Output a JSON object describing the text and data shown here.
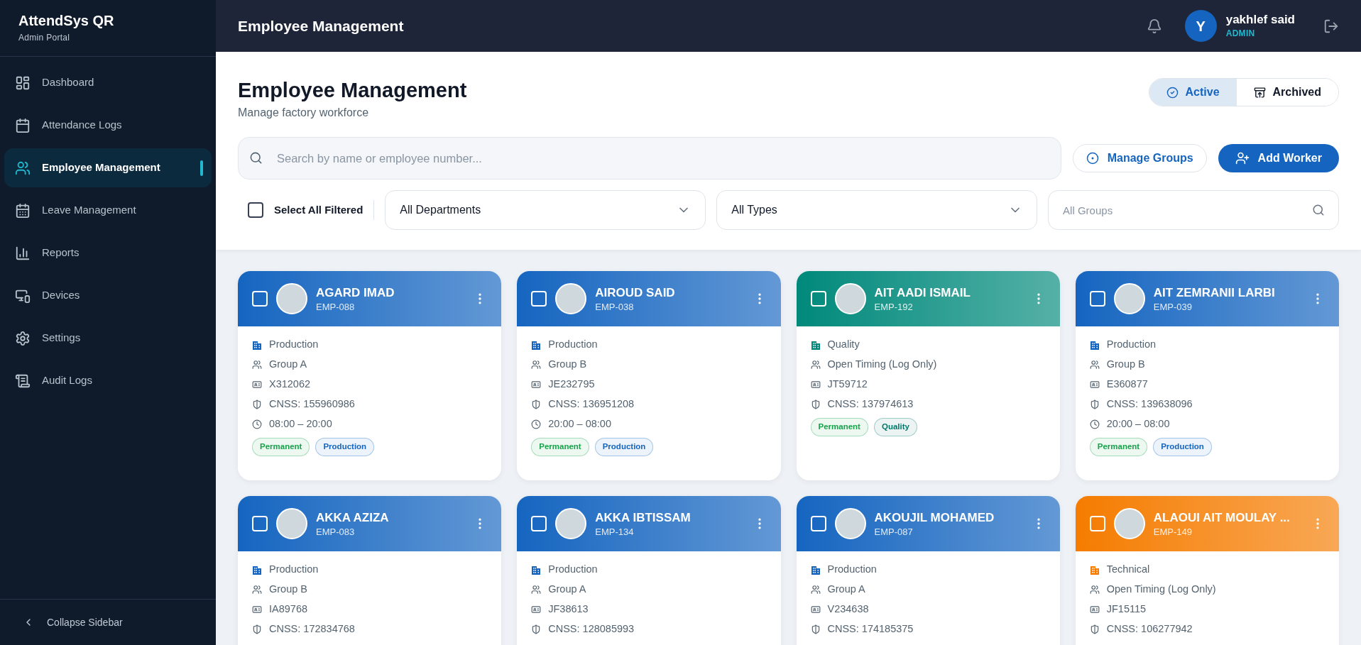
{
  "sidebar": {
    "brand": "AttendSys QR",
    "subtitle": "Admin Portal",
    "items": [
      {
        "label": "Dashboard",
        "selected": false
      },
      {
        "label": "Attendance Logs",
        "selected": false
      },
      {
        "label": "Employee Management",
        "selected": true
      },
      {
        "label": "Leave Management",
        "selected": false
      },
      {
        "label": "Reports",
        "selected": false
      },
      {
        "label": "Devices",
        "selected": false
      },
      {
        "label": "Settings",
        "selected": false
      },
      {
        "label": "Audit Logs",
        "selected": false
      }
    ],
    "collapse": "Collapse Sidebar"
  },
  "topbar": {
    "title": "Employee Management",
    "user": {
      "initial": "Y",
      "name": "yakhlef said",
      "role": "ADMIN"
    }
  },
  "header": {
    "title": "Employee Management",
    "subtitle": "Manage factory workforce",
    "status_toggle": [
      {
        "label": "Active",
        "selected": true
      },
      {
        "label": "Archived",
        "selected": false
      }
    ],
    "search": {
      "placeholder": "Search by name or employee number..."
    },
    "manage_groups": "Manage Groups",
    "add_worker": "Add Worker",
    "select_all": {
      "label": "Select All Filtered",
      "checked": false
    },
    "department_filter": "All Departments",
    "type_filter": "All Types",
    "group_filter": {
      "placeholder": "All Groups"
    }
  },
  "employees": [
    {
      "name": "AGARD IMAD",
      "id": "EMP-088",
      "color": "#1565c0",
      "checked": false,
      "department": "Production",
      "group": "Group A",
      "document": "X312062",
      "cnss": "CNSS: 155960986",
      "schedule": "08:00 – 20:00",
      "tags": [
        {
          "label": "Permanent",
          "color": "#16a34a"
        },
        {
          "label": "Production",
          "color": "#1565c0"
        }
      ]
    },
    {
      "name": "AIROUD SAID",
      "id": "EMP-038",
      "color": "#1565c0",
      "checked": false,
      "department": "Production",
      "group": "Group B",
      "document": "JE232795",
      "cnss": "CNSS: 136951208",
      "schedule": "20:00 – 08:00",
      "tags": [
        {
          "label": "Permanent",
          "color": "#16a34a"
        },
        {
          "label": "Production",
          "color": "#1565c0"
        }
      ]
    },
    {
      "name": "AIT AADI ISMAIL",
      "id": "EMP-192",
      "color": "#00897b",
      "checked": false,
      "department": "Quality",
      "group": "Open Timing (Log Only)",
      "document": "JT59712",
      "cnss": "CNSS: 137974613",
      "tags": [
        {
          "label": "Permanent",
          "color": "#16a34a"
        },
        {
          "label": "Quality",
          "color": "#00796b"
        }
      ]
    },
    {
      "name": "AIT ZEMRANII LARBI",
      "id": "EMP-039",
      "color": "#1565c0",
      "checked": false,
      "department": "Production",
      "group": "Group B",
      "document": "E360877",
      "cnss": "CNSS: 139638096",
      "schedule": "20:00 – 08:00",
      "tags": [
        {
          "label": "Permanent",
          "color": "#16a34a"
        },
        {
          "label": "Production",
          "color": "#1565c0"
        }
      ]
    },
    {
      "name": "AKKA AZIZA",
      "id": "EMP-083",
      "color": "#1565c0",
      "checked": false,
      "department": "Production",
      "group": "Group B",
      "document": "IA89768",
      "cnss": "CNSS: 172834768"
    },
    {
      "name": "AKKA IBTISSAM",
      "id": "EMP-134",
      "color": "#1565c0",
      "checked": false,
      "department": "Production",
      "group": "Group A",
      "document": "JF38613",
      "cnss": "CNSS: 128085993"
    },
    {
      "name": "AKOUJIL MOHAMED",
      "id": "EMP-087",
      "color": "#1565c0",
      "checked": false,
      "department": "Production",
      "group": "Group A",
      "document": "V234638",
      "cnss": "CNSS: 174185375"
    },
    {
      "name": "ALAOUI AIT MOULAY ...",
      "id": "EMP-149",
      "color": "#f57c00",
      "checked": false,
      "department": "Technical",
      "group": "Open Timing (Log Only)",
      "document": "JF15115",
      "cnss": "CNSS: 106277942"
    }
  ]
}
